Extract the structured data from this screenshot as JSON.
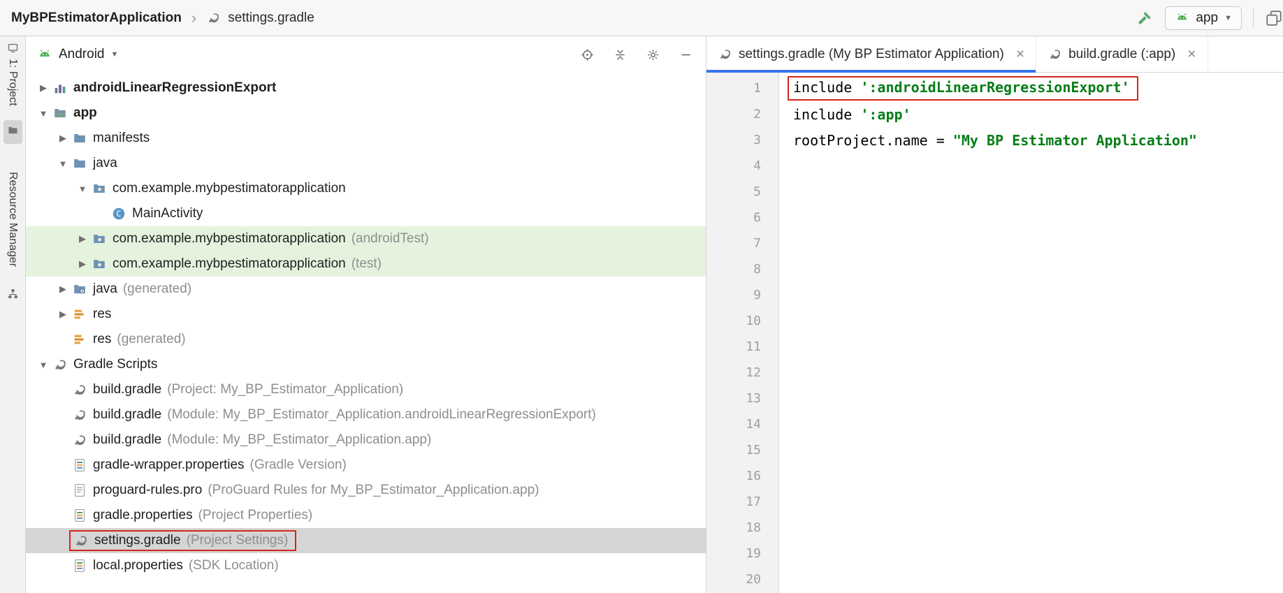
{
  "icons": {
    "chevron_collapsed": "▶",
    "chevron_expanded": "▼",
    "dropdown_arrow": "▼",
    "close": "×",
    "breadcrumb_separator": "›"
  },
  "breadcrumb": {
    "project": "MyBPEstimatorApplication",
    "file": "settings.gradle"
  },
  "toolbar": {
    "run_config": "app"
  },
  "left_stripe": {
    "project_tab": "1: Project",
    "resource_manager_tab": "Resource Manager"
  },
  "project_panel": {
    "view_selector": "Android",
    "tree": [
      {
        "label": "androidLinearRegressionExport",
        "hint": ""
      },
      {
        "label": "app",
        "hint": ""
      },
      {
        "label": "manifests",
        "hint": ""
      },
      {
        "label": "java",
        "hint": ""
      },
      {
        "label": "com.example.mybpestimatorapplication",
        "hint": ""
      },
      {
        "label": "MainActivity",
        "hint": ""
      },
      {
        "label": "com.example.mybpestimatorapplication",
        "hint": "(androidTest)"
      },
      {
        "label": "com.example.mybpestimatorapplication",
        "hint": "(test)"
      },
      {
        "label": "java",
        "hint": "(generated)"
      },
      {
        "label": "res",
        "hint": ""
      },
      {
        "label": "res",
        "hint": "(generated)"
      },
      {
        "label": "Gradle Scripts",
        "hint": ""
      },
      {
        "label": "build.gradle",
        "hint": "(Project: My_BP_Estimator_Application)"
      },
      {
        "label": "build.gradle",
        "hint": "(Module: My_BP_Estimator_Application.androidLinearRegressionExport)"
      },
      {
        "label": "build.gradle",
        "hint": "(Module: My_BP_Estimator_Application.app)"
      },
      {
        "label": "gradle-wrapper.properties",
        "hint": "(Gradle Version)"
      },
      {
        "label": "proguard-rules.pro",
        "hint": "(ProGuard Rules for My_BP_Estimator_Application.app)"
      },
      {
        "label": "gradle.properties",
        "hint": "(Project Properties)"
      },
      {
        "label": "settings.gradle",
        "hint": "(Project Settings)"
      },
      {
        "label": "local.properties",
        "hint": "(SDK Location)"
      }
    ]
  },
  "editor": {
    "tabs": [
      {
        "label": "settings.gradle (My BP Estimator Application)"
      },
      {
        "label": "build.gradle (:app)"
      }
    ],
    "line_numbers": [
      1,
      2,
      3,
      4,
      5,
      6,
      7,
      8,
      9,
      10,
      11,
      12,
      13,
      14,
      15,
      16,
      17,
      18,
      19,
      20
    ],
    "lines": [
      {
        "plain": "include ",
        "string": "':androidLinearRegressionExport'"
      },
      {
        "plain": "include ",
        "string": "':app'"
      },
      {
        "plain": "rootProject.name = ",
        "string": "\"My BP Estimator Application\""
      }
    ]
  }
}
